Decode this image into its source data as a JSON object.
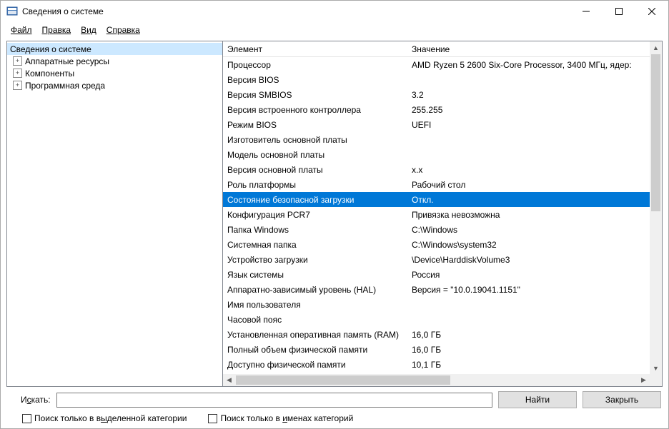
{
  "window": {
    "title": "Сведения о системе"
  },
  "menu": {
    "file": "Файл",
    "edit": "Правка",
    "view": "Вид",
    "help": "Справка"
  },
  "tree": {
    "root": "Сведения о системе",
    "items": [
      "Аппаратные ресурсы",
      "Компоненты",
      "Программная среда"
    ]
  },
  "columns": {
    "element": "Элемент",
    "value": "Значение"
  },
  "rows": [
    {
      "el": "Процессор",
      "val": "AMD Ryzen 5 2600 Six-Core Processor, 3400 МГц, ядер:",
      "sel": false
    },
    {
      "el": "Версия BIOS",
      "val": "",
      "sel": false
    },
    {
      "el": "Версия SMBIOS",
      "val": "3.2",
      "sel": false
    },
    {
      "el": "Версия встроенного контроллера",
      "val": "255.255",
      "sel": false
    },
    {
      "el": "Режим BIOS",
      "val": "UEFI",
      "sel": false
    },
    {
      "el": "Изготовитель основной платы",
      "val": "",
      "sel": false
    },
    {
      "el": "Модель основной платы",
      "val": "",
      "sel": false
    },
    {
      "el": "Версия основной платы",
      "val": "x.x",
      "sel": false
    },
    {
      "el": "Роль платформы",
      "val": "Рабочий стол",
      "sel": false
    },
    {
      "el": "Состояние безопасной загрузки",
      "val": "Откл.",
      "sel": true
    },
    {
      "el": "Конфигурация PCR7",
      "val": "Привязка невозможна",
      "sel": false
    },
    {
      "el": "Папка Windows",
      "val": "C:\\Windows",
      "sel": false
    },
    {
      "el": "Системная папка",
      "val": "C:\\Windows\\system32",
      "sel": false
    },
    {
      "el": "Устройство загрузки",
      "val": "\\Device\\HarddiskVolume3",
      "sel": false
    },
    {
      "el": "Язык системы",
      "val": "Россия",
      "sel": false
    },
    {
      "el": "Аппаратно-зависимый уровень (HAL)",
      "val": "Версия = \"10.0.19041.1151\"",
      "sel": false
    },
    {
      "el": "Имя пользователя",
      "val": "",
      "sel": false
    },
    {
      "el": "Часовой пояс",
      "val": "",
      "sel": false
    },
    {
      "el": "Установленная оперативная память (RAM)",
      "val": "16,0 ГБ",
      "sel": false
    },
    {
      "el": "Полный объем физической памяти",
      "val": "16,0 ГБ",
      "sel": false
    },
    {
      "el": "Доступно физической памяти",
      "val": "10,1 ГБ",
      "sel": false
    }
  ],
  "search": {
    "label_pre": "И",
    "label_ul": "с",
    "label_post": "кать:",
    "find": "Найти",
    "close": "Закрыть"
  },
  "checks": {
    "c1_pre": "Поиск только в в",
    "c1_ul": "ы",
    "c1_post": "деленной категории",
    "c2_pre": "Поиск только в ",
    "c2_ul": "и",
    "c2_post": "менах категорий"
  }
}
